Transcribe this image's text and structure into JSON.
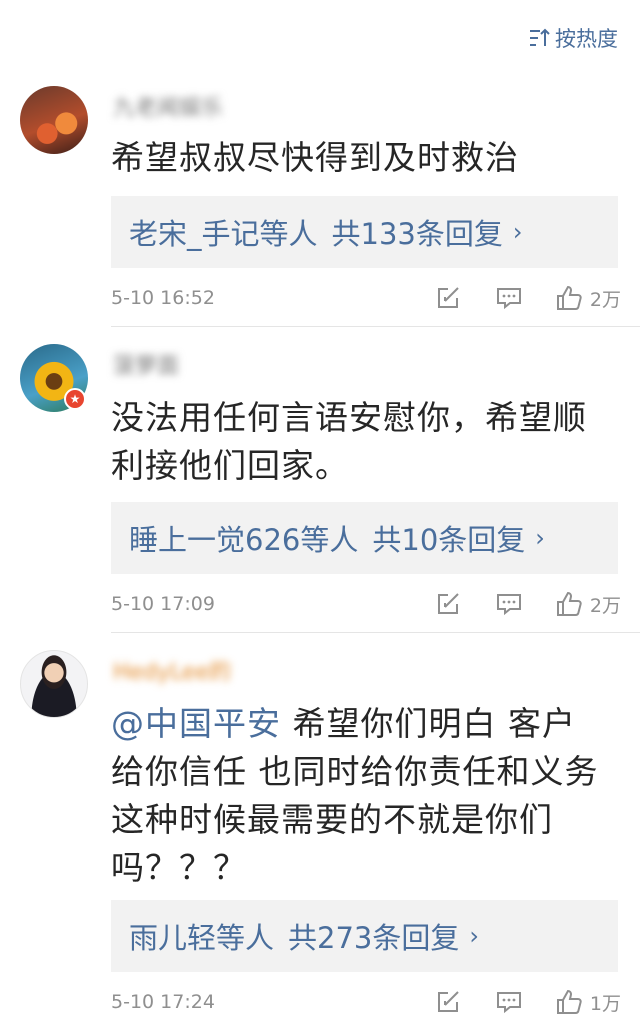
{
  "sort": {
    "label": "按热度",
    "icon": "sort-icon"
  },
  "comments": [
    {
      "avatar_icon": "avatar-orange-figures",
      "username": "九老闻娱乐",
      "text": "希望叔叔尽快得到及时救治",
      "reply_summary": {
        "who": "老宋_手记",
        "mid": "等人",
        "total": "共133条回复"
      },
      "time": "5-10 16:52",
      "likes": "2万"
    },
    {
      "avatar_icon": "avatar-sunflower",
      "username": "菠萝面",
      "text": "没法用任何言语安慰你，希望顺利接他们回家。",
      "reply_summary": {
        "who": "睡上一觉626",
        "mid": "等人",
        "total": "共10条回复"
      },
      "time": "5-10 17:09",
      "likes": "2万"
    },
    {
      "avatar_icon": "avatar-woman-portrait",
      "username": "HedyLee的",
      "mention": "@中国平安",
      "text": " 希望你们明白 客户给你信任 也同时给你责任和义务 这种时候最需要的不就是你们吗？？？",
      "reply_summary": {
        "who": "雨儿轻",
        "mid": "等人",
        "total": "共273条回复"
      },
      "time": "5-10 17:24",
      "likes": "1万"
    }
  ],
  "colors": {
    "link": "#4a6e9c",
    "reply_bg": "#f2f2f2",
    "meta": "#8f8f8f"
  }
}
